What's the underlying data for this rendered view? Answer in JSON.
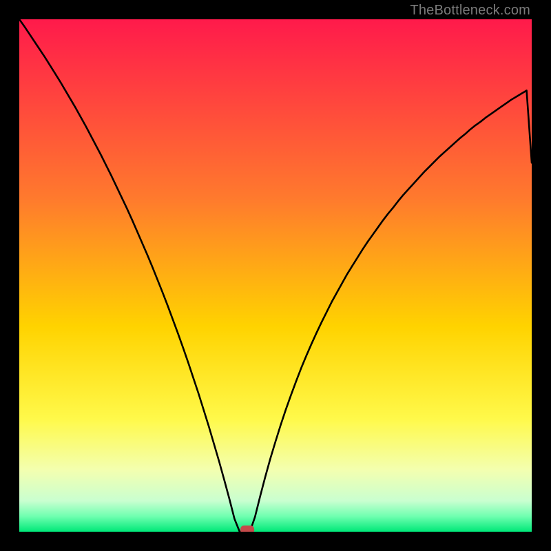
{
  "watermark": "TheBottleneck.com",
  "chart_data": {
    "type": "line",
    "title": "",
    "xlabel": "",
    "ylabel": "",
    "xlim": [
      0,
      100
    ],
    "ylim": [
      0,
      100
    ],
    "x": [
      0,
      1,
      2,
      3,
      4,
      5,
      6,
      7,
      8,
      9,
      10,
      11,
      12,
      13,
      14,
      15,
      16,
      17,
      18,
      19,
      20,
      21,
      22,
      23,
      24,
      25,
      26,
      27,
      28,
      29,
      30,
      31,
      32,
      33,
      34,
      35,
      36,
      37,
      38,
      39,
      40,
      41,
      42,
      43,
      44,
      45,
      46,
      47,
      48,
      49,
      50,
      51,
      52,
      53,
      54,
      55,
      56,
      57,
      58,
      59,
      60,
      61,
      62,
      63,
      64,
      65,
      66,
      67,
      68,
      69,
      70,
      71,
      72,
      73,
      74,
      75,
      76,
      77,
      78,
      79,
      80,
      81,
      82,
      83,
      84,
      85,
      86,
      87,
      88,
      89,
      90,
      91,
      92,
      93,
      94,
      95,
      96,
      97,
      98,
      99,
      100
    ],
    "values": [
      100.0,
      98.6,
      97.1,
      95.6,
      94.1,
      92.6,
      91.0,
      89.4,
      87.8,
      86.1,
      84.4,
      82.7,
      80.9,
      79.1,
      77.2,
      75.3,
      73.4,
      71.4,
      69.4,
      67.3,
      65.2,
      63.1,
      60.9,
      58.6,
      56.3,
      54.0,
      51.6,
      49.1,
      46.6,
      44.0,
      41.3,
      38.6,
      35.8,
      32.9,
      29.9,
      26.9,
      23.7,
      20.5,
      17.1,
      13.7,
      10.1,
      6.4,
      2.5,
      0.0,
      0.0,
      0.0,
      2.9,
      6.9,
      10.7,
      14.3,
      17.6,
      20.8,
      23.8,
      26.6,
      29.3,
      31.9,
      34.3,
      36.6,
      38.8,
      40.9,
      42.9,
      44.9,
      46.7,
      48.5,
      50.3,
      51.9,
      53.5,
      55.1,
      56.6,
      58.0,
      59.4,
      60.8,
      62.1,
      63.3,
      64.6,
      65.8,
      66.9,
      68.0,
      69.1,
      70.2,
      71.2,
      72.2,
      73.2,
      74.1,
      75.0,
      75.9,
      76.8,
      77.6,
      78.5,
      79.3,
      80.0,
      80.8,
      81.5,
      82.2,
      82.9,
      83.6,
      84.3,
      84.9,
      85.5,
      86.1,
      72.0
    ],
    "marker": {
      "x": 44.5,
      "y": 0.0
    },
    "background_gradient_stops": [
      {
        "pct": 0,
        "color": "#ff1a4b"
      },
      {
        "pct": 35,
        "color": "#ff7a2d"
      },
      {
        "pct": 60,
        "color": "#ffd300"
      },
      {
        "pct": 78,
        "color": "#fff94a"
      },
      {
        "pct": 88,
        "color": "#f3ffb0"
      },
      {
        "pct": 94,
        "color": "#c9ffd0"
      },
      {
        "pct": 97,
        "color": "#6fffb0"
      },
      {
        "pct": 100,
        "color": "#00e878"
      }
    ]
  }
}
